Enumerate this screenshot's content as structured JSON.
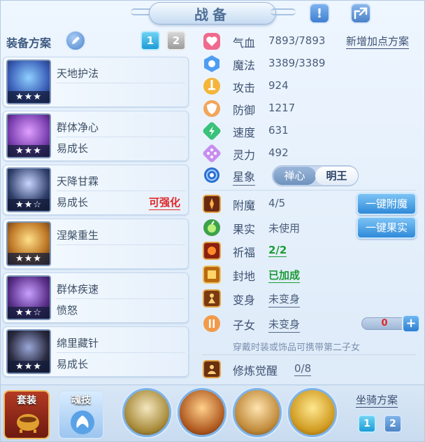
{
  "window": {
    "title": "战备"
  },
  "header": {
    "hint_icon": "exclamation-icon",
    "share_icon": "share-icon"
  },
  "left": {
    "plan_label": "装备方案",
    "plan_tabs": [
      "1",
      "2"
    ],
    "skills": [
      {
        "name": "天地护法",
        "sub": "",
        "stars": "★★★",
        "upgrade": "",
        "color": "#3b5fb8"
      },
      {
        "name": "群体净心",
        "sub": "易成长",
        "stars": "★★★",
        "upgrade": "",
        "color": "#7a3fb0"
      },
      {
        "name": "天降甘霖",
        "sub": "易成长",
        "stars": "★★☆",
        "upgrade": "可强化",
        "color": "#2f3f6a"
      },
      {
        "name": "涅槃重生",
        "sub": "",
        "stars": "★★★",
        "upgrade": "",
        "color": "#c07a28"
      },
      {
        "name": "群体疾速",
        "sub": "愤怒",
        "stars": "★★☆",
        "upgrade": "",
        "color": "#5a2f8a"
      },
      {
        "name": "绵里藏针",
        "sub": "易成长",
        "stars": "★★★",
        "upgrade": "",
        "color": "#2a2a40"
      }
    ]
  },
  "stats": {
    "hp": {
      "label": "气血",
      "value": "7893/7893",
      "icon": "heart-icon"
    },
    "mp": {
      "label": "魔法",
      "value": "3389/3389",
      "icon": "mana-icon"
    },
    "atk": {
      "label": "攻击",
      "value": "924",
      "icon": "sword-icon"
    },
    "def": {
      "label": "防御",
      "value": "1217",
      "icon": "shield-icon"
    },
    "spd": {
      "label": "速度",
      "value": "631",
      "icon": "speed-icon"
    },
    "spirit": {
      "label": "灵力",
      "value": "492",
      "icon": "spirit-icon"
    },
    "add_points": "新增加点方案"
  },
  "star": {
    "label": "星象",
    "options": [
      "禅心",
      "明王"
    ]
  },
  "extras": {
    "enchant": {
      "label": "附魔",
      "value": "4/5",
      "button": "一键附魔"
    },
    "fruit": {
      "label": "果实",
      "value": "未使用",
      "button": "一键果实"
    },
    "bless": {
      "label": "祈福",
      "value": "2/2"
    },
    "seal": {
      "label": "封地",
      "value": "已加成"
    },
    "transform": {
      "label": "变身",
      "value": "未变身"
    },
    "child": {
      "label": "子女",
      "value": "未变身",
      "count": "0",
      "plus": "+"
    },
    "child_note": "穿戴时装或饰品可携带第二子女",
    "awaken": {
      "label": "修炼觉醒",
      "value": "0/8"
    }
  },
  "bottom": {
    "suit_label": "套装",
    "soul_label": "魂技",
    "mount_label": "坐骑方案",
    "mount_tabs": [
      "1",
      "2"
    ]
  }
}
